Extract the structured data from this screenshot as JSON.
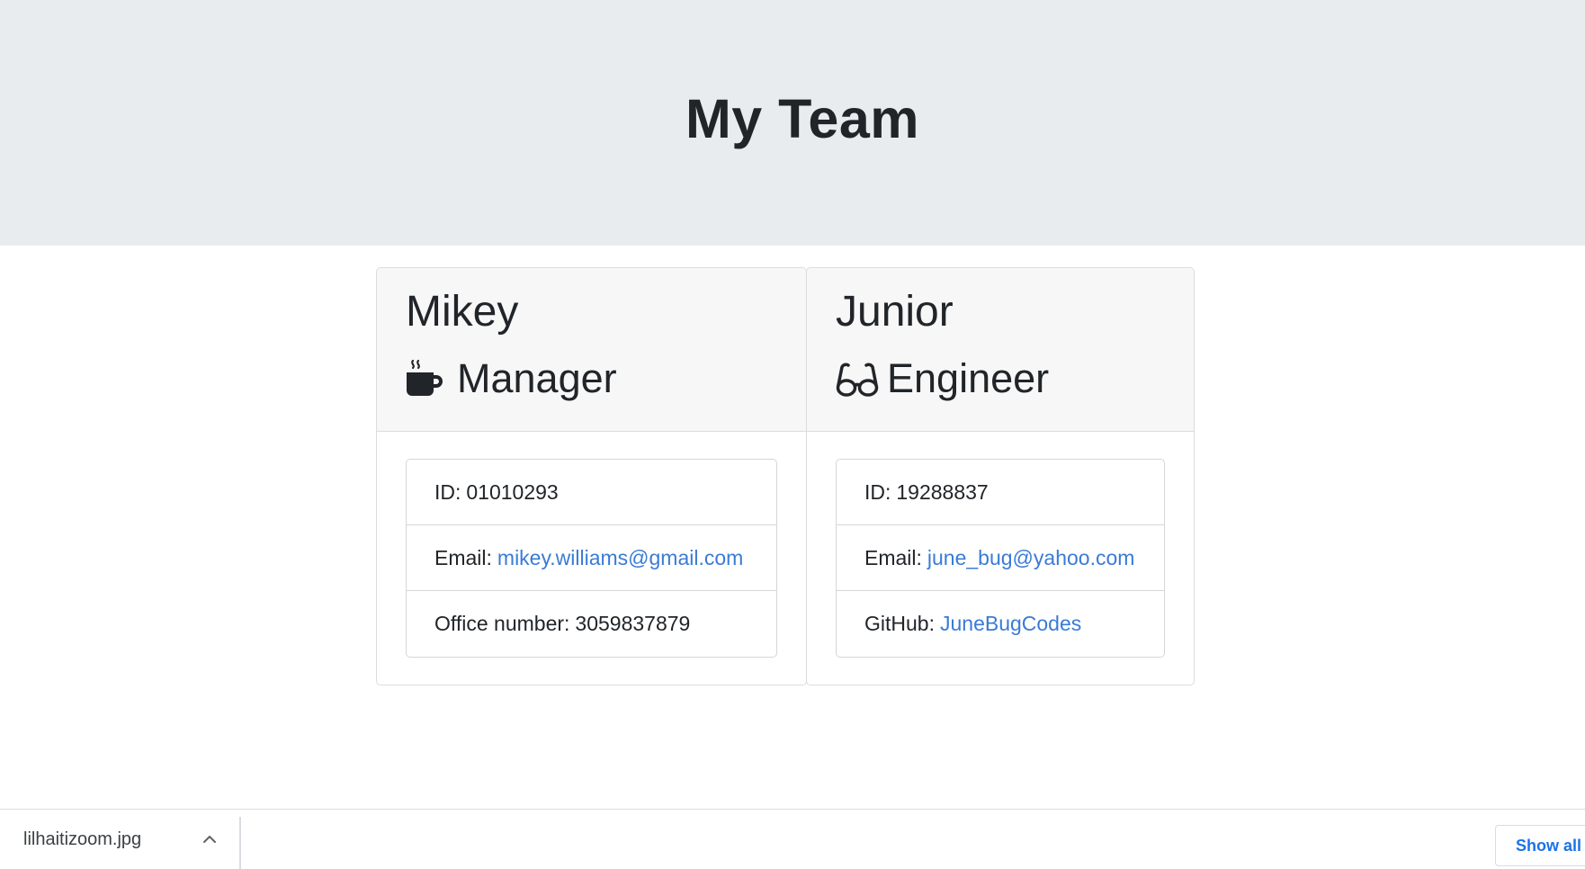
{
  "header": {
    "title": "My Team"
  },
  "team": [
    {
      "name": "Mikey",
      "role": "Manager",
      "role_icon": "coffee-mug-icon",
      "id_label": "ID:",
      "id": "01010293",
      "email_label": "Email:",
      "email": "mikey.williams@gmail.com",
      "extra_label": "Office number:",
      "extra_value": "3059837879"
    },
    {
      "name": "Junior",
      "role": "Engineer",
      "role_icon": "glasses-icon",
      "id_label": "ID:",
      "id": "19288837",
      "email_label": "Email:",
      "email": "june_bug@yahoo.com",
      "extra_label": "GitHub:",
      "extra_value": "JuneBugCodes"
    }
  ],
  "download_bar": {
    "filename": "lilhaitizoom.jpg",
    "show_all_label": "Show all"
  },
  "colors": {
    "jumbotron_bg": "#e9ecef",
    "card_header_bg": "#f7f7f7",
    "link": "#3a7bd5",
    "text": "#212529"
  }
}
